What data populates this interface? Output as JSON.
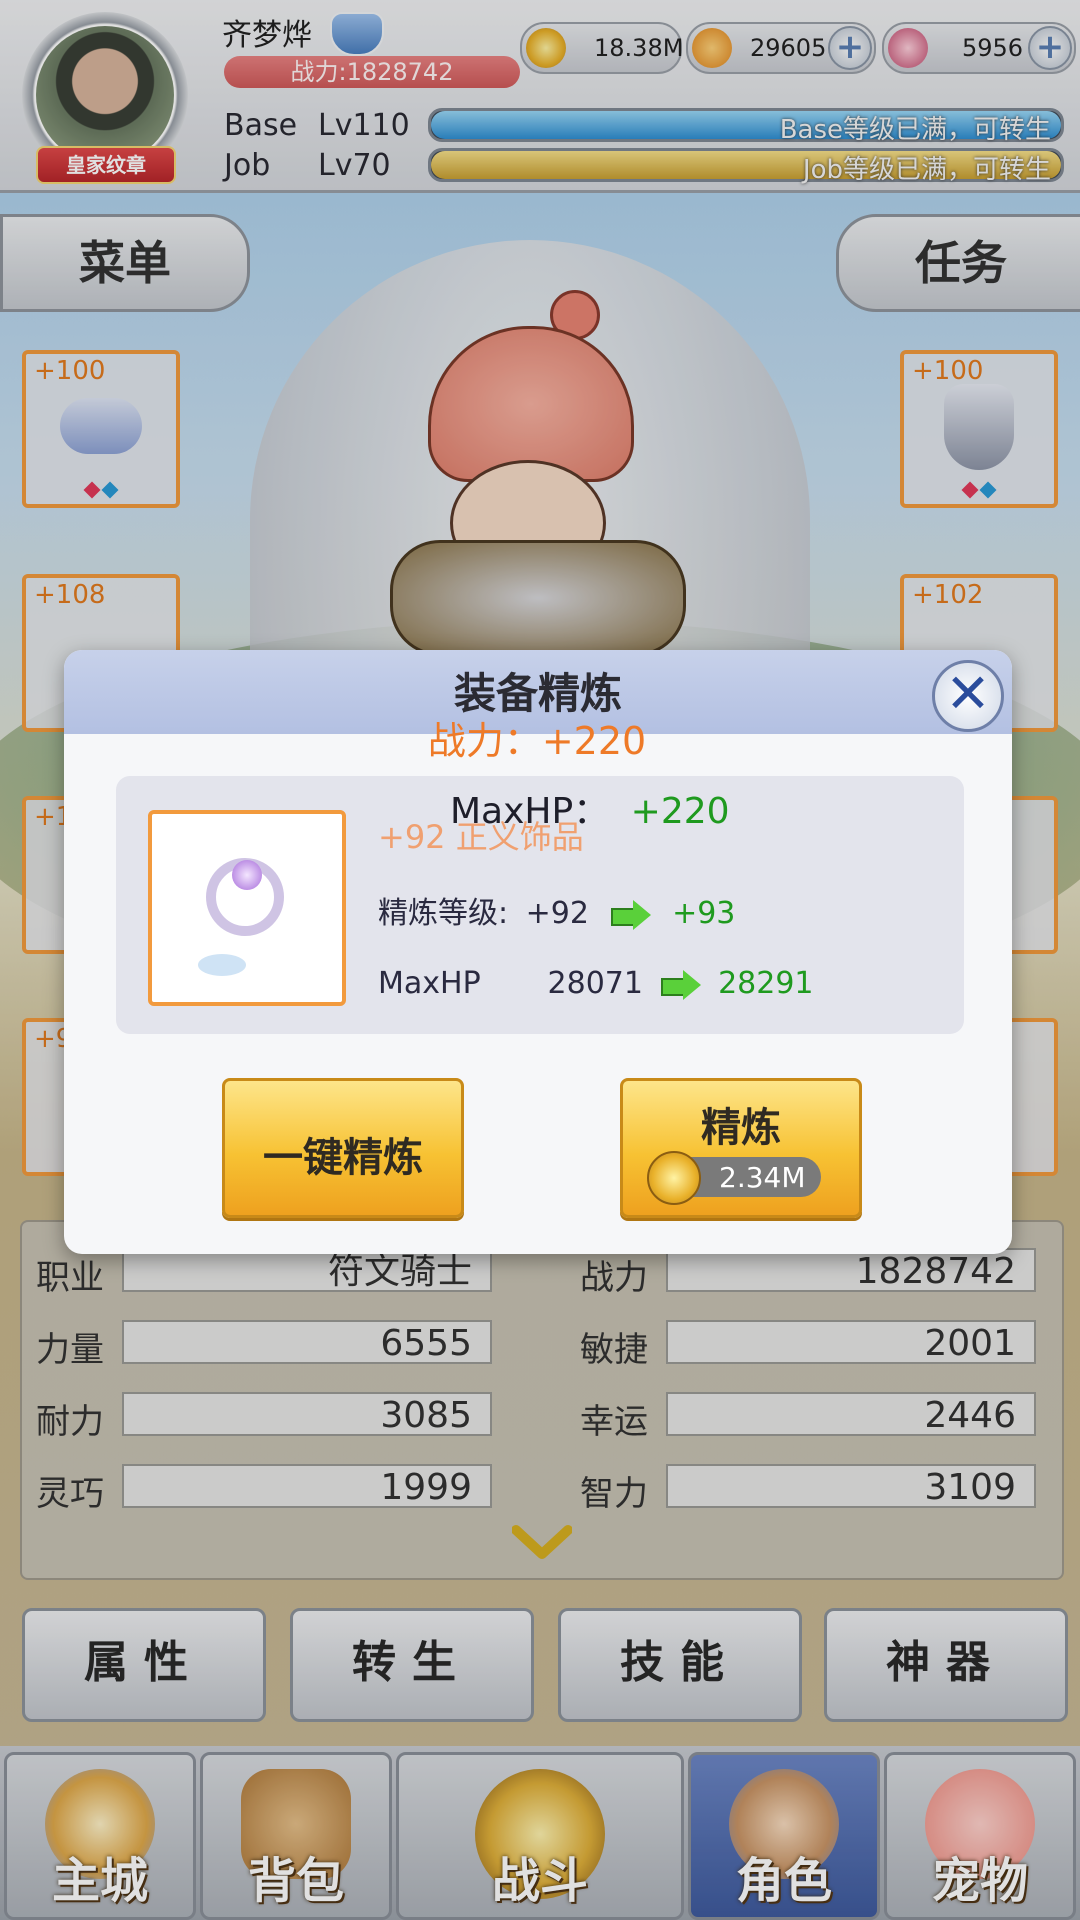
{
  "player": {
    "name": "齐梦烨",
    "power_label": "战力:1828742",
    "badge": "皇家纹章"
  },
  "levels": {
    "base_label": "Base",
    "base_level": "Lv110",
    "base_status": "Base等级已满，可转生",
    "base_fill": 1.0,
    "job_label": "Job",
    "job_level": "Lv70",
    "job_status": "Job等级已满，可转生",
    "job_fill": 1.0
  },
  "currencies": [
    {
      "icon": "zeny-coin-icon",
      "value": "18.38M"
    },
    {
      "icon": "poring-coin-icon",
      "value": "29605"
    },
    {
      "icon": "crystal-icon",
      "value": "5956"
    }
  ],
  "tabs": {
    "menu": "菜单",
    "task": "任务"
  },
  "slots": {
    "left": [
      "+100",
      "+108",
      "+1",
      "+9"
    ],
    "right": [
      "+100",
      "+102"
    ]
  },
  "dialog": {
    "title": "装备精炼",
    "power_gain": "战力：+220",
    "maxhp_gain_label": "MaxHP：",
    "maxhp_gain_value": "+220",
    "item_name": "+92 正义饰品",
    "refine_label": "精炼等级:",
    "refine_from": "+92",
    "refine_to": "+93",
    "stat_label": "MaxHP",
    "stat_from": "28071",
    "stat_to": "28291",
    "btn_auto": "一键精炼",
    "btn_refine": "精炼",
    "refine_cost": "2.34M",
    "close_symbol": "✕"
  },
  "stats": [
    {
      "label": "职业",
      "value": "符文骑士"
    },
    {
      "label": "战力",
      "value": "1828742"
    },
    {
      "label": "力量",
      "value": "6555"
    },
    {
      "label": "敏捷",
      "value": "2001"
    },
    {
      "label": "耐力",
      "value": "3085"
    },
    {
      "label": "幸运",
      "value": "2446"
    },
    {
      "label": "灵巧",
      "value": "1999"
    },
    {
      "label": "智力",
      "value": "3109"
    }
  ],
  "sub_buttons": [
    "属性",
    "转生",
    "技能",
    "神器"
  ],
  "nav": [
    {
      "label": "主城",
      "icon": "castle-icon",
      "active": false
    },
    {
      "label": "背包",
      "icon": "backpack-icon",
      "active": false
    },
    {
      "label": "战斗",
      "icon": "battle-wheel-icon",
      "active": false
    },
    {
      "label": "角色",
      "icon": "character-icon",
      "active": true
    },
    {
      "label": "宠物",
      "icon": "pet-poring-icon",
      "active": false
    }
  ],
  "colors": {
    "accent_orange": "#ee7a28",
    "gain_green": "#1f9a1f",
    "gold_button": "#f7c233"
  }
}
